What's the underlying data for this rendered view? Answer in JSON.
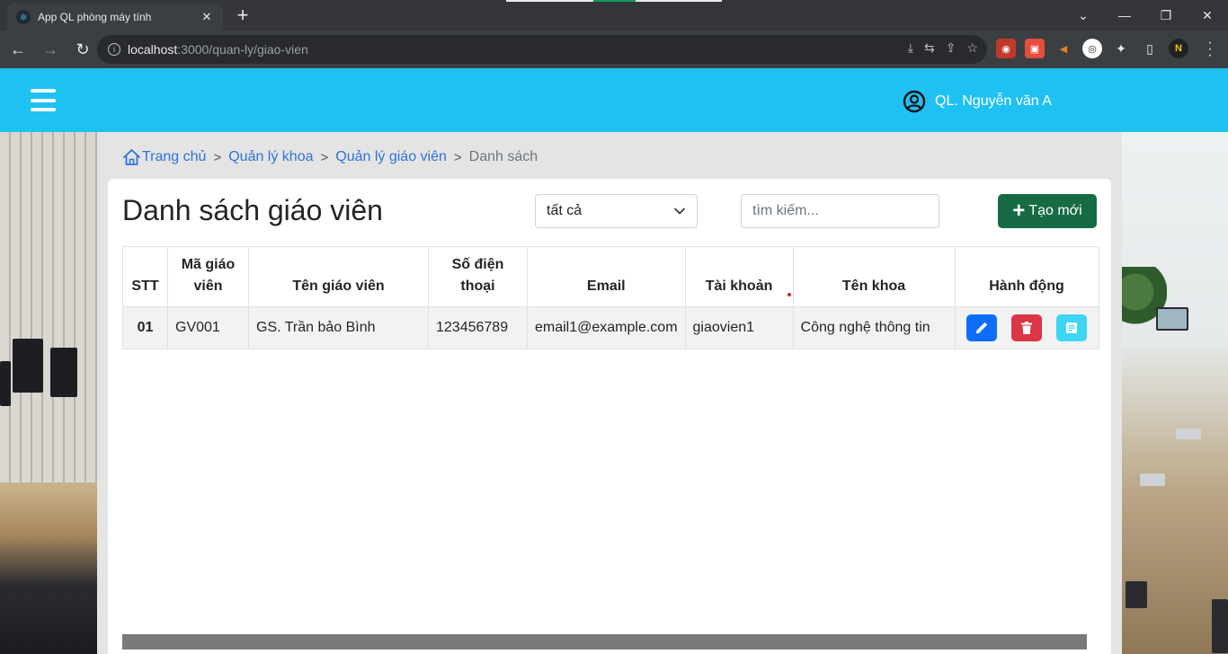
{
  "browser": {
    "tab_title": "App QL phòng máy tính",
    "tab_close": "✕",
    "new_tab": "+",
    "window": {
      "minimize": "—",
      "restore": "❐",
      "close": "✕",
      "tabsearch": "⌄"
    },
    "url_host": "localhost",
    "url_path": ":3000/quan-ly/giao-vien"
  },
  "header": {
    "user_name": "QL. Nguyễn văn A"
  },
  "breadcrumb": {
    "home": "Trang chủ",
    "khoa": "Quản lý khoa",
    "giaovien": "Quản lý giáo viên",
    "current": "Danh sách",
    "separator": ">"
  },
  "card": {
    "title": "Danh sách giáo viên",
    "filter_value": "tất cả",
    "search_placeholder": "tìm kiếm...",
    "create_label": "Tạo mới"
  },
  "table": {
    "headers": {
      "stt": "STT",
      "ma": "Mã giáo viên",
      "ten": "Tên giáo viên",
      "sdt": "Số điện thoại",
      "email": "Email",
      "tk": "Tài khoản",
      "khoa": "Tên khoa",
      "act": "Hành động"
    },
    "rows": [
      {
        "stt": "01",
        "ma": "GV001",
        "ten": "GS. Trần bảo Bình",
        "sdt": "123456789",
        "email": "email1@example.com",
        "tk": "giaovien1",
        "khoa": "Công nghệ thông tin"
      }
    ]
  },
  "colors": {
    "header_bg": "#1fc1f3",
    "create_btn": "#166b45",
    "edit_btn": "#0d6efd",
    "delete_btn": "#dc3545",
    "view_btn": "#3dd5f3",
    "link": "#2f73d8"
  }
}
